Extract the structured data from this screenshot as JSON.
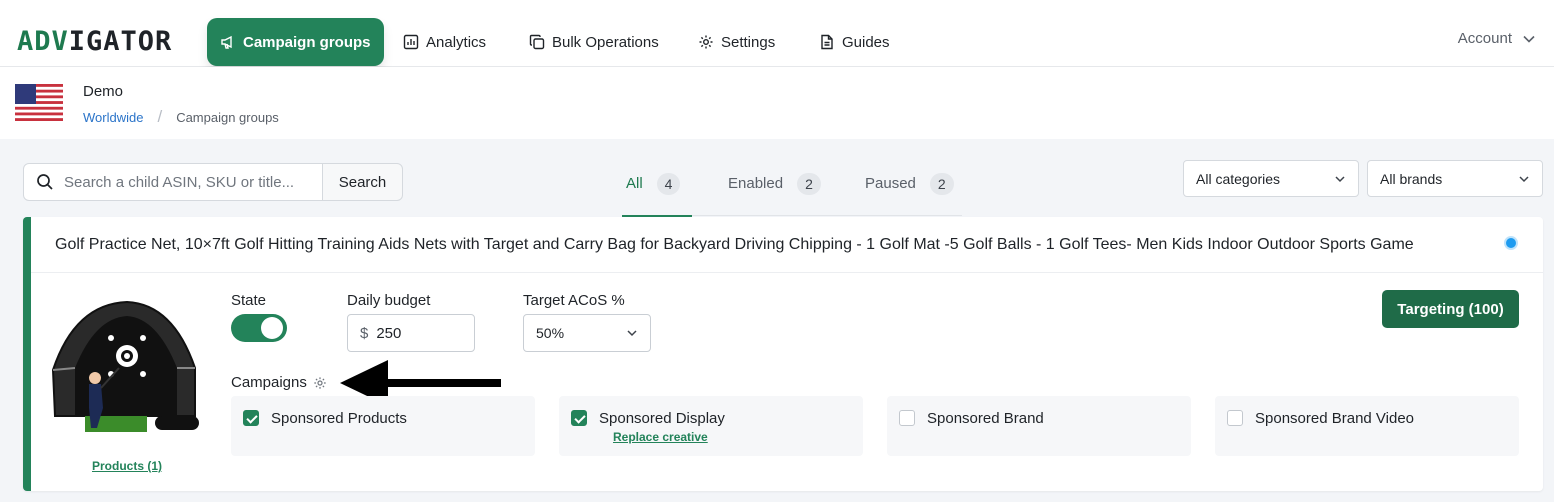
{
  "brand": {
    "logo_a": "ADV",
    "logo_b": "IGATOR"
  },
  "nav": {
    "items": [
      {
        "label": "Campaign groups",
        "icon": "megaphone-icon",
        "active": true
      },
      {
        "label": "Analytics",
        "icon": "bar-chart-icon"
      },
      {
        "label": "Bulk Operations",
        "icon": "copy-icon"
      },
      {
        "label": "Settings",
        "icon": "gear-icon"
      },
      {
        "label": "Guides",
        "icon": "document-icon"
      }
    ],
    "account": "Account"
  },
  "header": {
    "store": "Demo",
    "breadcrumb": [
      "Worldwide",
      "Campaign groups"
    ],
    "flag": "us-flag-icon"
  },
  "search": {
    "placeholder": "Search a child ASIN, SKU or title...",
    "button": "Search"
  },
  "tabs": [
    {
      "label": "All",
      "count": "4",
      "active": true
    },
    {
      "label": "Enabled",
      "count": "2"
    },
    {
      "label": "Paused",
      "count": "2"
    }
  ],
  "filters": {
    "categories": "All categories",
    "brands": "All brands"
  },
  "card": {
    "title": "Golf Practice Net, 10×7ft Golf Hitting Training Aids Nets with Target and Carry Bag for Backyard Driving Chipping - 1 Golf Mat -5 Golf Balls - 1 Golf Tees- Men Kids Indoor Outdoor Sports Game",
    "products_link": "Products (1)",
    "state_label": "State",
    "state_on": true,
    "budget_label": "Daily budget",
    "currency": "$",
    "budget_value": "250",
    "acos_label": "Target ACoS %",
    "acos_value": "50%",
    "targeting_button": "Targeting (100)",
    "campaigns_label": "Campaigns",
    "campaigns": [
      {
        "name": "Sponsored Products",
        "checked": true,
        "sub": ""
      },
      {
        "name": "Sponsored Display",
        "checked": true,
        "sub": "Replace creative"
      },
      {
        "name": "Sponsored Brand",
        "checked": false,
        "sub": ""
      },
      {
        "name": "Sponsored Brand Video",
        "checked": false,
        "sub": ""
      }
    ]
  },
  "colors": {
    "accent": "#23835a",
    "dark_accent": "#1f6b48",
    "link": "#2b74c9",
    "dot": "#1d9bf0"
  }
}
